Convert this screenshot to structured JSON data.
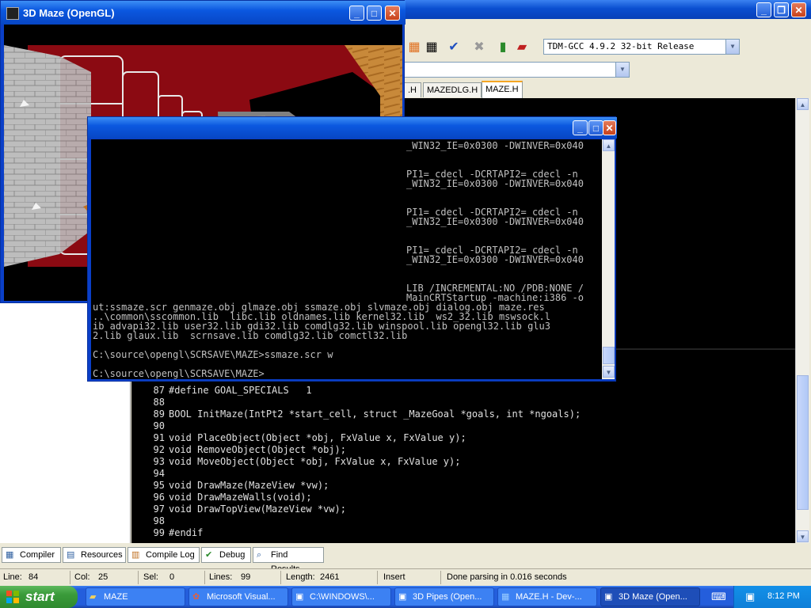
{
  "devcpp": {
    "compiler": "TDM-GCC 4.9.2 32-bit Release",
    "tabs": [
      ".H",
      "MAZEDLG.H",
      "MAZE.H"
    ],
    "code_lines": [
      {
        "num": "87",
        "text": "#define GOAL_SPECIALS   1"
      },
      {
        "num": "88",
        "text": ""
      },
      {
        "num": "89",
        "text": "BOOL InitMaze(IntPt2 *start_cell, struct _MazeGoal *goals, int *ngoals);"
      },
      {
        "num": "90",
        "text": ""
      },
      {
        "num": "91",
        "text": "void PlaceObject(Object *obj, FxValue x, FxValue y);"
      },
      {
        "num": "92",
        "text": "void RemoveObject(Object *obj);"
      },
      {
        "num": "93",
        "text": "void MoveObject(Object *obj, FxValue x, FxValue y);"
      },
      {
        "num": "94",
        "text": ""
      },
      {
        "num": "95",
        "text": "void DrawMaze(MazeView *vw);"
      },
      {
        "num": "96",
        "text": "void DrawMazeWalls(void);"
      },
      {
        "num": "97",
        "text": "void DrawTopView(MazeView *vw);"
      },
      {
        "num": "98",
        "text": ""
      },
      {
        "num": "99",
        "text": "#endif"
      }
    ],
    "bottom_tabs": [
      "Compiler",
      "Resources",
      "Compile Log",
      "Debug",
      "Find Results"
    ],
    "status": {
      "line_label": "Line:",
      "line": "84",
      "col_label": "Col:",
      "col": "25",
      "sel_label": "Sel:",
      "sel": "0",
      "lines_label": "Lines:",
      "lines": "99",
      "length_label": "Length:",
      "length": "2461",
      "mode": "Insert",
      "message": "Done parsing in 0.016 seconds"
    }
  },
  "maze_window": {
    "title": "3D Maze (OpenGL)"
  },
  "console": {
    "lines": [
      "_WIN32_IE=0x0300 -DWINVER=0x040",
      "",
      "",
      "PI1=_cdecl -DCRTAPI2=_cdecl -n",
      "_WIN32_IE=0x0300 -DWINVER=0x040",
      "",
      "",
      "PI1=_cdecl -DCRTAPI2=_cdecl -n",
      "_WIN32_IE=0x0300 -DWINVER=0x040",
      "",
      "",
      "PI1=_cdecl -DCRTAPI2=_cdecl -n",
      "_WIN32_IE=0x0300 -DWINVER=0x040",
      "",
      "",
      "LIB /INCREMENTAL:NO /PDB:NONE /",
      "MainCRTStartup -machine:i386 -o",
      "ut:ssmaze.scr genmaze.obj glmaze.obj ssmaze.obj slvmaze.obj dialog.obj maze.res",
      "..\\common\\sscommon.lib  libc.lib oldnames.lib kernel32.lib  ws2_32.lib mswsock.l",
      "ib advapi32.lib user32.lib gdi32.lib comdlg32.lib winspool.lib opengl32.lib glu3",
      "2.lib glaux.lib  scrnsave.lib comdlg32.lib comctl32.lib",
      "",
      "C:\\source\\opengl\\SCRSAVE\\MAZE>ssmaze.scr w",
      "",
      "C:\\source\\opengl\\SCRSAVE\\MAZE>"
    ]
  },
  "taskbar": {
    "start_label": "start",
    "tasks": [
      {
        "label": "MAZE",
        "icon": "folder-icon"
      },
      {
        "label": "Microsoft Visual...",
        "icon": "visual-studio-icon"
      },
      {
        "label": "C:\\WINDOWS\\...",
        "icon": "console-icon"
      },
      {
        "label": "3D Pipes (Open...",
        "icon": "app-window-icon"
      },
      {
        "label": "MAZE.H - Dev-...",
        "icon": "devcpp-icon"
      },
      {
        "label": "3D Maze (Open...",
        "icon": "app-window-icon"
      }
    ],
    "clock": "8:12 PM"
  },
  "colors": {
    "xp_blue": "#245edc",
    "start_green": "#3a9a3a",
    "maze_wall_red": "#8b0a12",
    "maze_brick_gray": "#c8c8c8",
    "maze_floor_wood": "#c8893a"
  }
}
